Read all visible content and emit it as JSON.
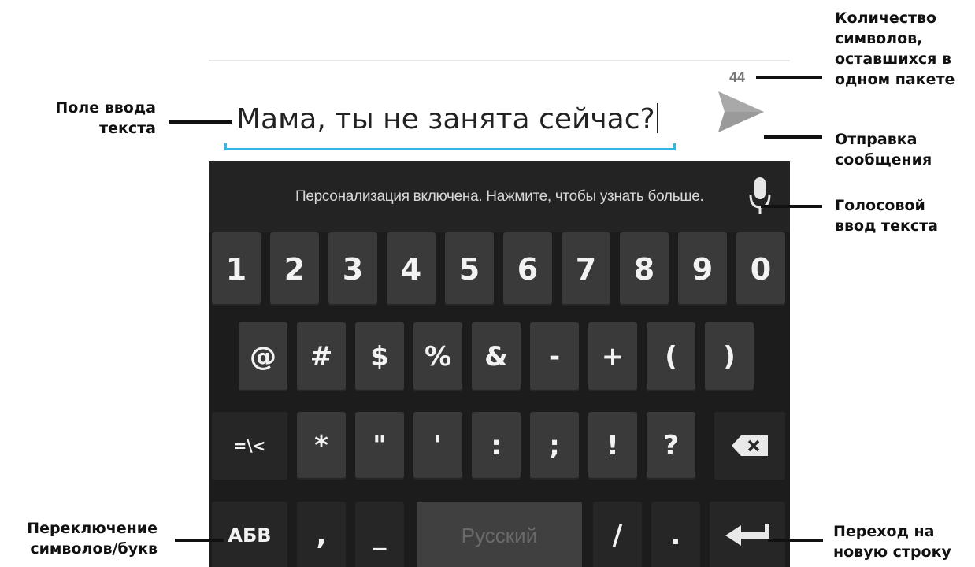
{
  "message": {
    "text": "Мама, ты не занята сейчас?",
    "remaining_count": "44"
  },
  "keyboard": {
    "strip_text": "Персонализация включена. Нажмите, чтобы узнать больше.",
    "row1": [
      "1",
      "2",
      "3",
      "4",
      "5",
      "6",
      "7",
      "8",
      "9",
      "0"
    ],
    "row2": [
      "@",
      "#",
      "$",
      "%",
      "&",
      "-",
      "+",
      "(",
      ")"
    ],
    "row3": [
      "=\\<",
      "*",
      "\"",
      "'",
      ":",
      ";",
      "!",
      "?"
    ],
    "row4": {
      "switch_label": "АБВ",
      "comma": ",",
      "underscore": "_",
      "space_label": "Русский",
      "slash": "/",
      "dot": "."
    }
  },
  "annotations": {
    "input_field": [
      "Поле ввода",
      "текста"
    ],
    "char_count": [
      "Количество",
      "символов,",
      "оставшихся в",
      "одном пакете"
    ],
    "send": [
      "Отправка",
      "сообщения"
    ],
    "voice": [
      "Голосовой",
      "ввод текста"
    ],
    "switch": [
      "Переключение",
      "символов/букв"
    ],
    "newline": [
      "Переход на",
      "новую строку"
    ]
  },
  "colors": {
    "accent": "#33b5e5",
    "keyboard_bg": "#1c1c1c",
    "key_bg": "#3a3a3a"
  }
}
